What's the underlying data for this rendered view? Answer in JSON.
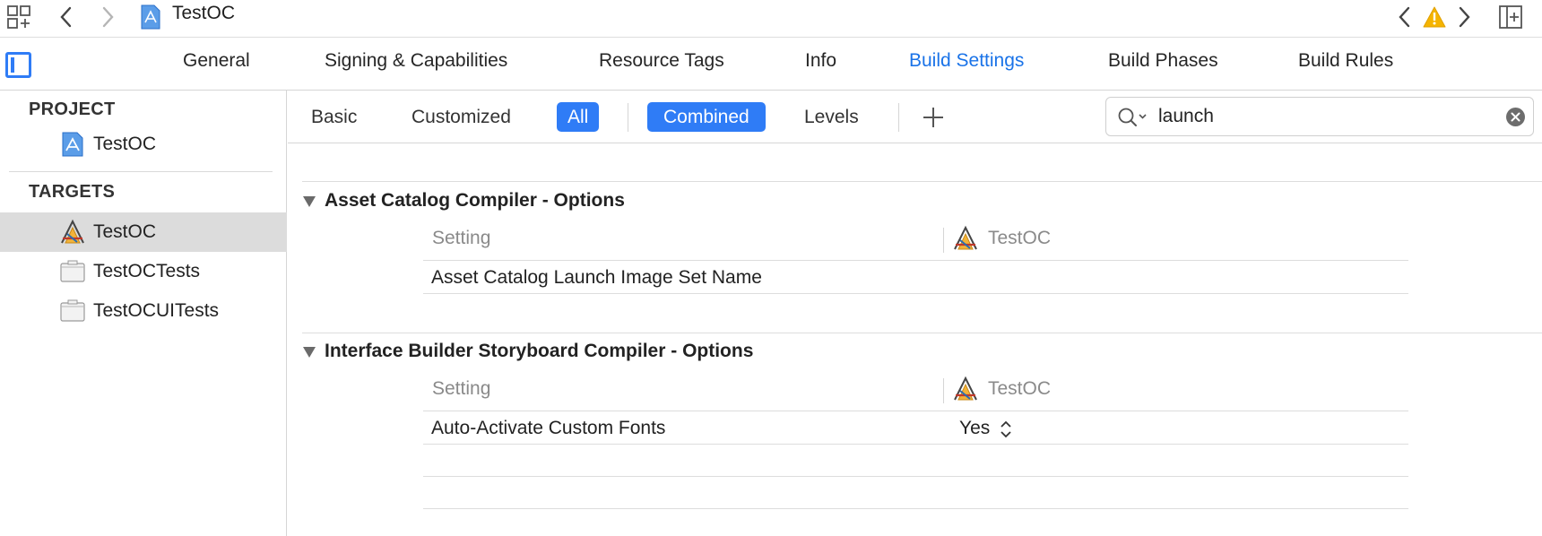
{
  "jumpbar": {
    "title": "TestOC",
    "icons": [
      "related-items-icon",
      "back-chevron-icon",
      "forward-chevron-icon",
      "project-file-icon",
      "previous-issue-icon",
      "warning-icon",
      "next-issue-icon",
      "add-editor-icon"
    ]
  },
  "tabs": [
    {
      "label": "General",
      "active": false
    },
    {
      "label": "Signing & Capabilities",
      "active": false
    },
    {
      "label": "Resource Tags",
      "active": false
    },
    {
      "label": "Info",
      "active": false
    },
    {
      "label": "Build Settings",
      "active": true
    },
    {
      "label": "Build Phases",
      "active": false
    },
    {
      "label": "Build Rules",
      "active": false
    }
  ],
  "sidebar": {
    "project_header": "PROJECT",
    "project_item": "TestOC",
    "targets_header": "TARGETS",
    "targets": [
      {
        "label": "TestOC",
        "selected": true
      },
      {
        "label": "TestOCTests",
        "selected": false
      },
      {
        "label": "TestOCUITests",
        "selected": false
      }
    ]
  },
  "filters": {
    "basic": "Basic",
    "customized": "Customized",
    "all": "All",
    "combined": "Combined",
    "levels": "Levels",
    "active_scope": "All",
    "active_view": "Combined"
  },
  "search": {
    "value": "launch"
  },
  "sections": [
    {
      "title": "Asset Catalog Compiler - Options",
      "col_setting": "Setting",
      "col_target": "TestOC",
      "rows": [
        {
          "setting": "Asset Catalog Launch Image Set Name",
          "value": ""
        }
      ]
    },
    {
      "title": "Interface Builder Storyboard Compiler - Options",
      "col_setting": "Setting",
      "col_target": "TestOC",
      "rows": [
        {
          "setting": "Auto-Activate Custom Fonts",
          "value": "Yes"
        }
      ]
    }
  ],
  "colors": {
    "accent": "#2f7cf6",
    "active_tab": "#1a73e8",
    "warning": "#f5b400",
    "selection": "#dcdcdc"
  }
}
